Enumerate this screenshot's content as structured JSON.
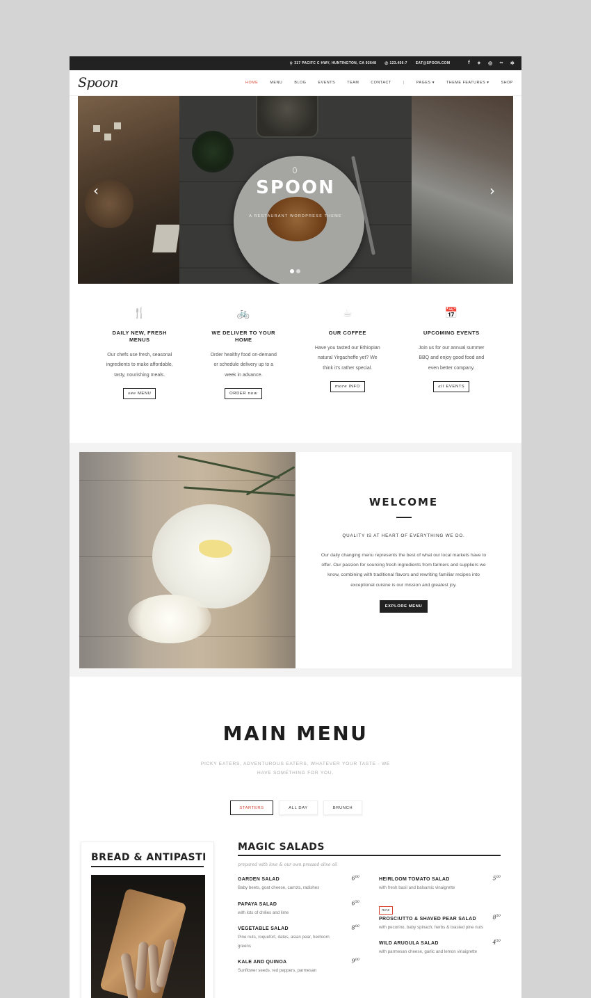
{
  "topbar": {
    "address": "317 PACIFC C HWY, HUNTINGTON, CA 92648",
    "phone": "123.456-7",
    "email": "EAT@SPOON.COM",
    "social_icons": [
      "facebook-icon",
      "twitter-icon",
      "instagram-icon",
      "tripadvisor-icon",
      "yelp-icon"
    ]
  },
  "header": {
    "logo": "Spoon",
    "nav": [
      "HOME",
      "MENU",
      "BLOG",
      "EVENTS",
      "TEAM",
      "CONTACT"
    ],
    "nav_sep": "|",
    "nav_extra": [
      "PAGES ▾",
      "THEME FEATURES ▾",
      "SHOP"
    ]
  },
  "hero": {
    "title": "SPOON",
    "subtitle": "A RESTAURANT WORDPRESS THEME",
    "prev": "‹",
    "next": "›",
    "slide_count": 2,
    "active_slide": 0
  },
  "features": [
    {
      "icon": "utensils-icon",
      "glyph": "🍴",
      "title": "DAILY NEW, FRESH MENUS",
      "text": "Our chefs use fresh, seasonal ingredients to make affordable, tasty, nourishing meals.",
      "btn_a": "see",
      "btn_b": "MENU"
    },
    {
      "icon": "bicycle-icon",
      "glyph": "🚲",
      "title": "WE DELIVER TO YOUR HOME",
      "text": "Order healthy food on-demand or schedule delivery up to a week in advance.",
      "btn_a": "ORDER",
      "btn_b": "now"
    },
    {
      "icon": "coffee-icon",
      "glyph": "☕",
      "title": "OUR COFFEE",
      "text": "Have you tasted our Ethiopian natural Yirgacheffe yet? We think it's rather special.",
      "btn_a": "more",
      "btn_b": "INFO"
    },
    {
      "icon": "calendar-icon",
      "glyph": "📅",
      "title": "UPCOMING EVENTS",
      "text": "Join us for our annual summer BBQ and enjoy good food and even better company.",
      "btn_a": "all",
      "btn_b": "EVENTS"
    }
  ],
  "welcome": {
    "title": "WELCOME",
    "subtitle": "QUALITY IS AT HEART OF EVERYTHING WE DO.",
    "text": "Our daily changing menu represents the best of what our local markets have to offer. Our passion for sourcing fresh ingredients from farmers and suppliers we know, combining with traditional flavors and rewriting familiar recipes into exceptional cuisine is our mission and greatest joy.",
    "button": "EXPLORE MENU"
  },
  "main_menu": {
    "title": "MAIN MENU",
    "subtitle": "PICKY EATERS, ADVENTUROUS EATERS, WHATEVER YOUR TASTE - WE HAVE SOMETHING FOR YOU.",
    "tabs": [
      "STARTERS",
      "ALL DAY",
      "BRUNCH"
    ],
    "active_tab": 0
  },
  "bread": {
    "title": "BREAD & ANTIPASTI"
  },
  "salads": {
    "title": "MAGIC SALADS",
    "note": "prepared with love & our own pressed olive oil",
    "left": [
      {
        "name": "GARDEN SALAD",
        "desc": "Baby beets, goat cheese, carrots, radishes",
        "price": "6",
        "cents": "00"
      },
      {
        "name": "PAPAYA SALAD",
        "desc": "with lots of chilies and lime",
        "price": "6",
        "cents": "50"
      },
      {
        "name": "VEGETABLE SALAD",
        "desc": "Pine nuts, roquefort, dates, asian pear, heirloom greens",
        "price": "8",
        "cents": "00"
      },
      {
        "name": "KALE AND QUINOA",
        "desc": "Sunflower seeds, red peppers, parmesan",
        "price": "9",
        "cents": "00"
      }
    ],
    "right": [
      {
        "name": "HEIRLOOM TOMATO SALAD",
        "desc": "with fresh basil and balsamic vinaigrette",
        "price": "5",
        "cents": "00",
        "badge": ""
      },
      {
        "name": "PROSCIUTTO & SHAVED PEAR SALAD",
        "desc": "with pecorino, baby spinach, herbs & toasted pine nuts",
        "price": "8",
        "cents": "50",
        "badge": "new"
      },
      {
        "name": "WILD ARUGULA SALAD",
        "desc": "with parmesan cheese, garlic and lemon vinaigrette",
        "price": "4",
        "cents": "50",
        "badge": ""
      }
    ]
  },
  "colors": {
    "accent": "#d9432f",
    "dark": "#222222",
    "backdrop": "#d4d4d4"
  }
}
